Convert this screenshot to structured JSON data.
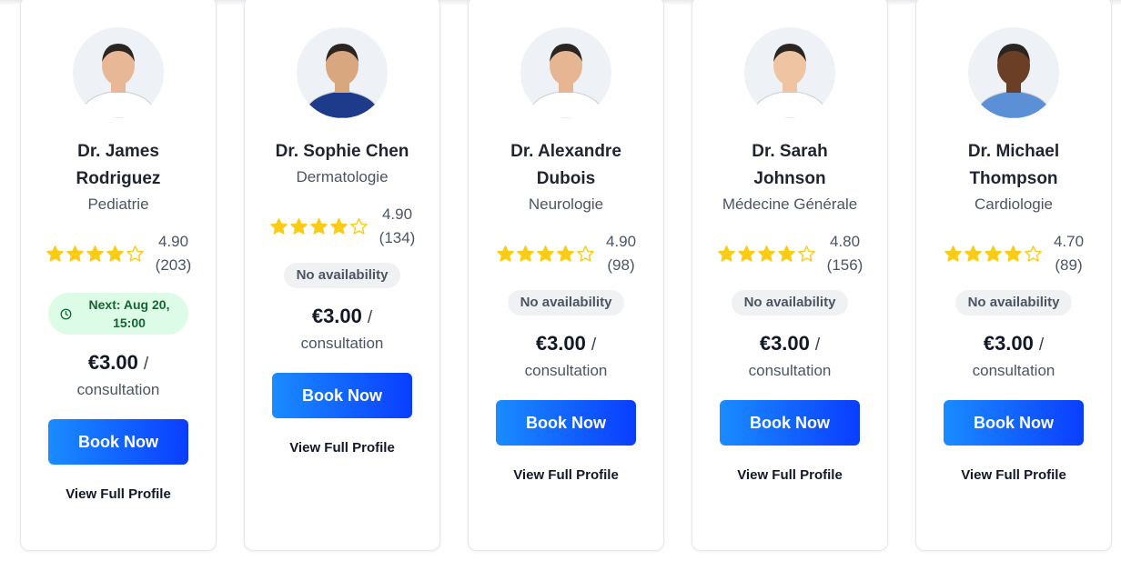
{
  "doctors": [
    {
      "name_line1": "Dr. James",
      "name_line2": "Rodriguez",
      "specialty": "Pediatrie",
      "rating": "4.90",
      "reviews": "(203)",
      "stars_filled": 4,
      "availability": "",
      "next_slot_line1": "Next: Aug 20,",
      "next_slot_line2": "15:00",
      "price": "€3.00",
      "price_sep": "/",
      "price_unit": "consultation",
      "book_label": "Book Now",
      "profile_label": "View Full Profile",
      "scrub_color": "#ffffff",
      "skin": "#e8b896"
    },
    {
      "name_line1": "Dr. Sophie Chen",
      "name_line2": "",
      "specialty": "Dermatologie",
      "rating": "4.90",
      "reviews": "(134)",
      "stars_filled": 4,
      "availability": "No availability",
      "next_slot_line1": "",
      "next_slot_line2": "",
      "price": "€3.00",
      "price_sep": "/",
      "price_unit": "consultation",
      "book_label": "Book Now",
      "profile_label": "View Full Profile",
      "scrub_color": "#1e3a8a",
      "skin": "#d9a77f"
    },
    {
      "name_line1": "Dr. Alexandre",
      "name_line2": "Dubois",
      "specialty": "Neurologie",
      "rating": "4.90",
      "reviews": "(98)",
      "stars_filled": 4,
      "availability": "No availability",
      "next_slot_line1": "",
      "next_slot_line2": "",
      "price": "€3.00",
      "price_sep": "/",
      "price_unit": "consultation",
      "book_label": "Book Now",
      "profile_label": "View Full Profile",
      "scrub_color": "#ffffff",
      "skin": "#e6b592"
    },
    {
      "name_line1": "Dr. Sarah",
      "name_line2": "Johnson",
      "specialty": "Médecine Générale",
      "rating": "4.80",
      "reviews": "(156)",
      "stars_filled": 4,
      "availability": "No availability",
      "next_slot_line1": "",
      "next_slot_line2": "",
      "price": "€3.00",
      "price_sep": "/",
      "price_unit": "consultation",
      "book_label": "Book Now",
      "profile_label": "View Full Profile",
      "scrub_color": "#ffffff",
      "skin": "#efc4a2"
    },
    {
      "name_line1": "Dr. Michael",
      "name_line2": "Thompson",
      "specialty": "Cardiologie",
      "rating": "4.70",
      "reviews": "(89)",
      "stars_filled": 4,
      "availability": "No availability",
      "next_slot_line1": "",
      "next_slot_line2": "",
      "price": "€3.00",
      "price_sep": "/",
      "price_unit": "consultation",
      "book_label": "Book Now",
      "profile_label": "View Full Profile",
      "scrub_color": "#5b8fd6",
      "skin": "#6b3f26"
    }
  ],
  "colors": {
    "star": "#facc15",
    "button_start": "#1a8cff",
    "button_end": "#0a3dff",
    "next_bg": "#dcfce7",
    "next_text": "#166534"
  }
}
